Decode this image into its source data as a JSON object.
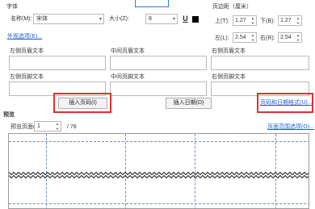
{
  "font_section": {
    "title": "字体",
    "name_label": "名称(M):",
    "name_value": "宋体",
    "size_label": "大小(Z):",
    "size_value": "8",
    "underline_glyph": "U",
    "more_link": "外观选项(E)..."
  },
  "margin_section": {
    "title": "页边距（厘米）",
    "top_label": "上(T):",
    "top_value": "1.27",
    "bottom_label": "下(B):",
    "bottom_value": "1.27",
    "left_label": "左(L):",
    "left_value": "2.54",
    "right_label": "右(R):",
    "right_value": "2.54"
  },
  "header_row": {
    "left": "左侧页眉文本",
    "center": "中间页眉文本",
    "right": "右侧页眉文本"
  },
  "footer_row": {
    "left": "左侧页脚文本",
    "center": "中间页脚文本",
    "right": "右侧页脚文本"
  },
  "buttons": {
    "insert_page": "插入页码(I)",
    "insert_date": "插入日期(D)",
    "page_date_format": "页码和日期格式(U)..."
  },
  "preview": {
    "title": "预览",
    "page_label": "预览页面(I):",
    "page_value": "1",
    "total": "/ 78",
    "range_link": "页面范围选项(O)..."
  },
  "colors": {
    "highlight": "#e03030",
    "link": "#1a5fd0",
    "accent": "#2b7bd9"
  }
}
